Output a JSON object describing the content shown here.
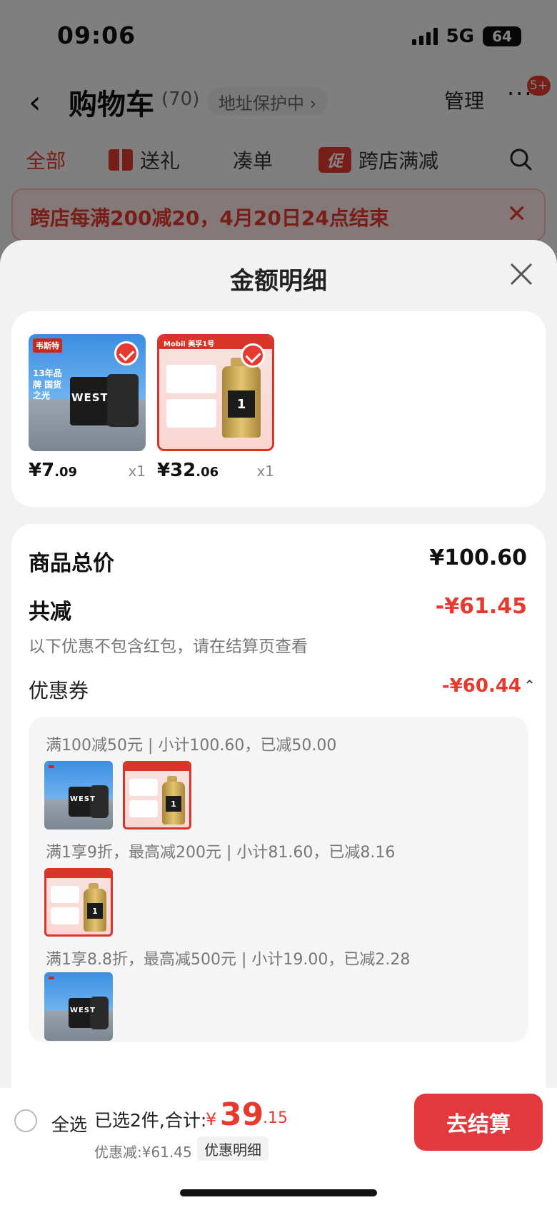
{
  "status": {
    "time": "09:06",
    "network": "5G",
    "battery": "64"
  },
  "nav": {
    "title": "购物车",
    "count": "(70)",
    "address_protect": "地址保护中 ›",
    "manage": "管理",
    "badge": "5+"
  },
  "tabs": [
    {
      "label": "全部"
    },
    {
      "label": "送礼"
    },
    {
      "label": "凑单"
    },
    {
      "label": "跨店满减",
      "tag": "促"
    }
  ],
  "promo_banner": {
    "text": "跨店每满200减20，4月20日24点结束"
  },
  "sheet": {
    "title": "金额明细",
    "items": [
      {
        "brand": "韦斯特",
        "slogan": "13年品牌 国货之光",
        "box_label": "WEST",
        "price_main": "¥7",
        "price_cents": ".09",
        "qty": "x1"
      },
      {
        "brand": "Mobil 美孚1号",
        "label": "1",
        "price_main": "¥32",
        "price_cents": ".06",
        "qty": "x1"
      }
    ],
    "summary": {
      "total_label": "商品总价",
      "total_value": "¥100.60",
      "reduce_label": "共减",
      "reduce_value": "-¥61.45",
      "note": "以下优惠不包含红包，请在结算页查看",
      "coupon_label": "优惠券",
      "coupon_value": "-¥60.44",
      "coupon_lines": [
        "满100减50元 | 小计100.60，已减50.00",
        "满1享9折，最高减200元 | 小计81.60，已减8.16",
        "满1享8.8折，最高减500元 | 小计19.00，已减2.28"
      ]
    }
  },
  "bottom_bar": {
    "select_all": "全选",
    "selected_info": "已选2件,合计:",
    "currency": "¥",
    "total_int": "39",
    "total_cents": ".15",
    "discount": "优惠减:¥61.45",
    "detail_btn": "优惠明细",
    "checkout": "去结算"
  },
  "colors": {
    "accent": "#e63a2f",
    "checkout": "#e4393c"
  }
}
